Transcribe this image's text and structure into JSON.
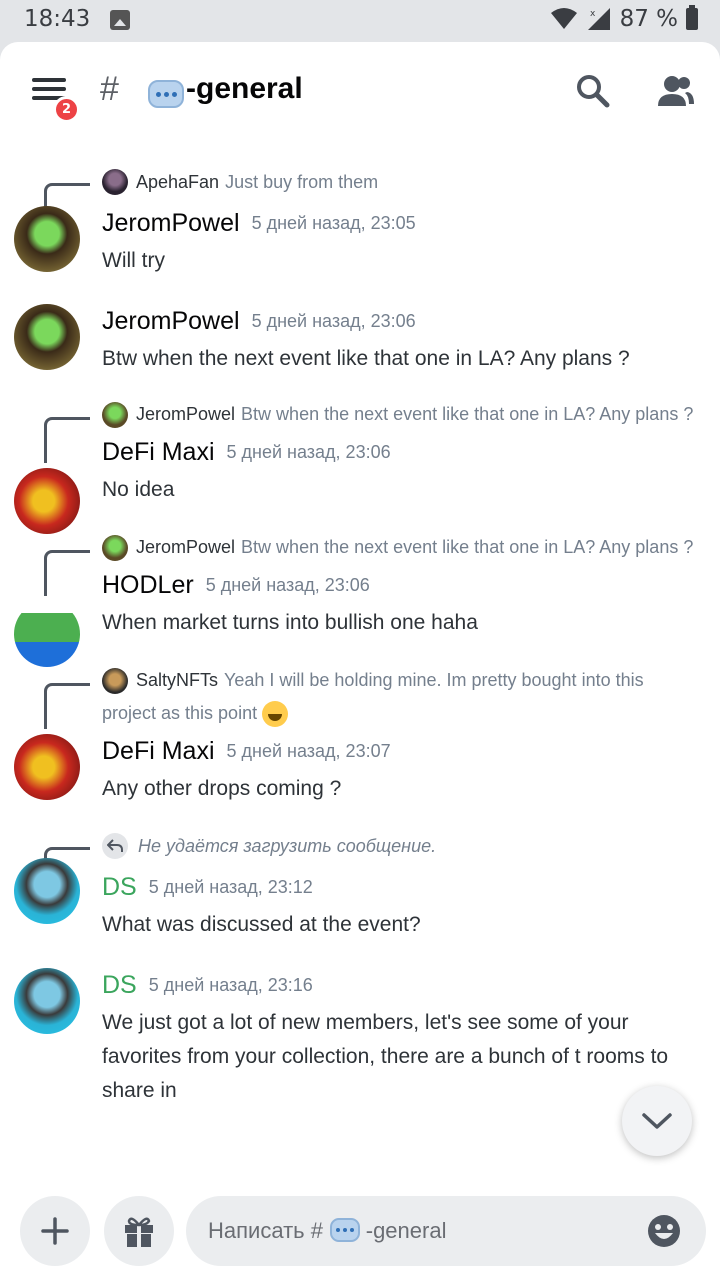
{
  "status_bar": {
    "time": "18:43",
    "battery": "87 %"
  },
  "header": {
    "badge_count": "2",
    "hash": "#",
    "channel_name": "-general",
    "emoji_icon": "speech-bubble-icon"
  },
  "messages": [
    {
      "reply": {
        "author": "ApehaFan",
        "text": "Just buy from them"
      },
      "author": "JeromPowel",
      "timestamp": "5 дней назад, 23:05",
      "content": "Will try"
    },
    {
      "author": "JeromPowel",
      "timestamp": "5 дней назад, 23:06",
      "content": "Btw when the next event like that one in LA? Any plans ?"
    },
    {
      "reply": {
        "author": "JeromPowel",
        "text": "Btw when the next event like that one in LA? Any plans ?"
      },
      "author": "DeFi Maxi",
      "timestamp": "5 дней назад, 23:06",
      "content": "No idea"
    },
    {
      "reply": {
        "author": "JeromPowel",
        "text": "Btw when the next event like that one in LA? Any plans ?"
      },
      "author": "HODLer",
      "timestamp": "5 дней назад, 23:06",
      "content": "When market turns into bullish one haha"
    },
    {
      "reply": {
        "author": "SaltyNFTs",
        "text": "Yeah I will be holding mine. Im pretty bought into this project as this point"
      },
      "author": "DeFi Maxi",
      "timestamp": "5 дней назад, 23:07",
      "content": "Any other drops coming ?"
    },
    {
      "reply": {
        "text": "Не удаётся загрузить сообщение."
      },
      "author": "DS",
      "timestamp": "5 дней назад, 23:12",
      "content": "What was discussed  at the event?"
    },
    {
      "author": "DS",
      "timestamp": "5 дней назад, 23:16",
      "content": "We just got a lot of new members, let's see some of your favorites from your collection, there are a bunch of t rooms to share in"
    }
  ],
  "composer": {
    "placeholder": "Написать #       -general"
  },
  "colors": {
    "accent_green": "#3ba55d",
    "badge_red": "#ed4245"
  }
}
